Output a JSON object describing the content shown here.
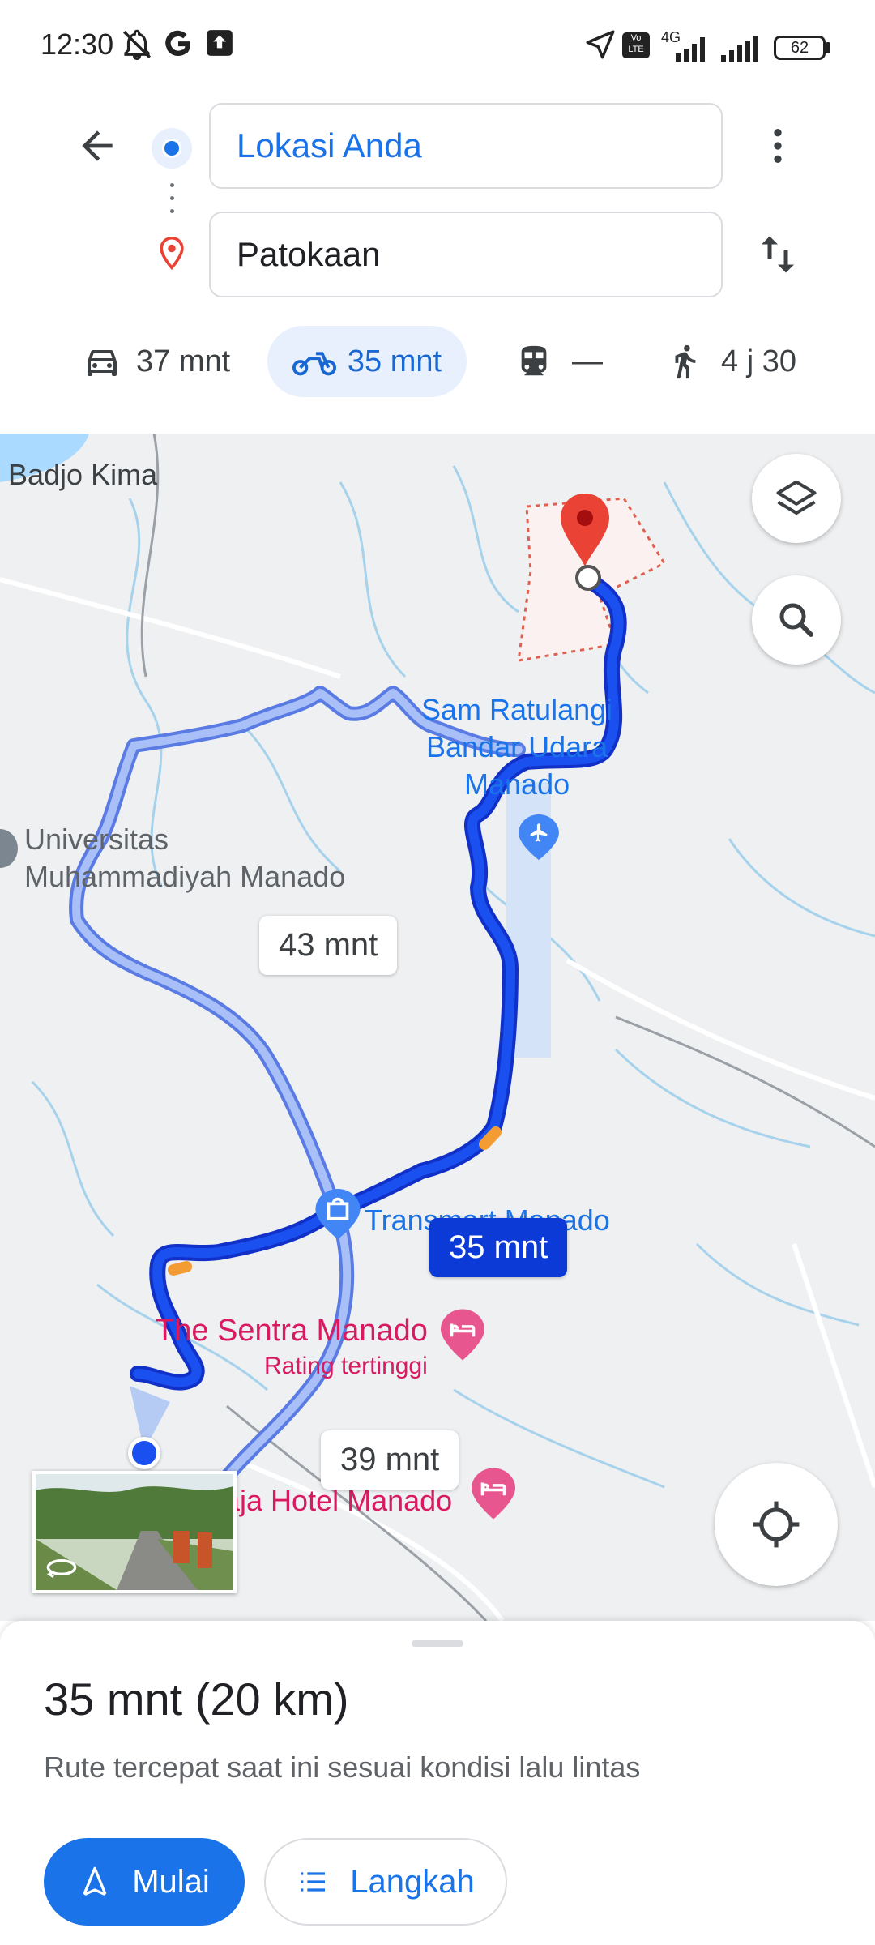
{
  "status_bar": {
    "time": "12:30",
    "network": "4G",
    "volte": "Vo LTE",
    "battery": "62"
  },
  "directions": {
    "origin": "Lokasi Anda",
    "destination": "Patokaan",
    "modes": [
      {
        "id": "car",
        "icon": "car-icon",
        "label": "37 mnt",
        "selected": false
      },
      {
        "id": "motorcycle",
        "icon": "motorcycle-icon",
        "label": "35 mnt",
        "selected": true
      },
      {
        "id": "transit",
        "icon": "train-icon",
        "label": "—",
        "selected": false
      },
      {
        "id": "walk",
        "icon": "walk-icon",
        "label": "4 j 30",
        "selected": false
      }
    ]
  },
  "map": {
    "labels": {
      "badjo": "Badjo Kima",
      "airport": "Sam Ratulangi Bandar Udara Manado",
      "airport_l1": "Sam Ratulangi",
      "airport_l2": "Bandar Udara",
      "airport_l3": "Manado",
      "univ_l1": "Universitas",
      "univ_l2": "Muhammadiyah Manado",
      "transmart": "Transmart Manado",
      "sentra": "The Sentra Manado",
      "sentra_sub": "Rating tertinggi",
      "hotel": "aja Hotel Manado"
    },
    "route_times": {
      "alt1": "43 mnt",
      "main": "35 mnt",
      "alt2": "39 mnt"
    },
    "colors": {
      "route_main": "#1a4ff0",
      "route_alt": "#a8c0f7",
      "pin": "#ea4335"
    }
  },
  "sheet": {
    "summary": "35 mnt (20 km)",
    "note": "Rute tercepat saat ini sesuai kondisi lalu lintas",
    "start_label": "Mulai",
    "steps_label": "Langkah"
  }
}
